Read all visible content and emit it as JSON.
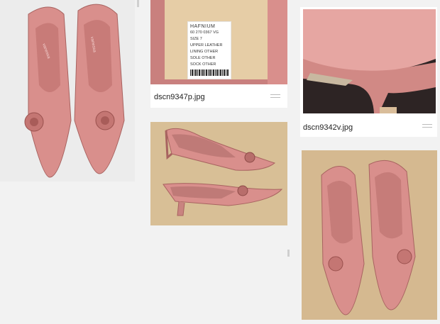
{
  "gallery": {
    "items": [
      {
        "id": "main",
        "caption": ""
      },
      {
        "id": "label",
        "caption": "dscn9347p.jpg"
      },
      {
        "id": "heel",
        "caption": "dscn9342v.jpg"
      },
      {
        "id": "side",
        "caption": ""
      },
      {
        "id": "top",
        "caption": ""
      }
    ]
  },
  "label_text": {
    "brand": "HAFNIUM",
    "code": "60 270 0367 VG",
    "size": "SIZE 7",
    "lines": [
      "UPPER LEATHER",
      "LINING OTHER",
      "SOLE OTHER",
      "SOCK OTHER"
    ]
  },
  "insole_text": "vanessa",
  "colors": {
    "leather": "#d98f8c",
    "leather_dark": "#b86e6b",
    "leather_light": "#eab0ad",
    "background_beige": "#d9c29a"
  }
}
